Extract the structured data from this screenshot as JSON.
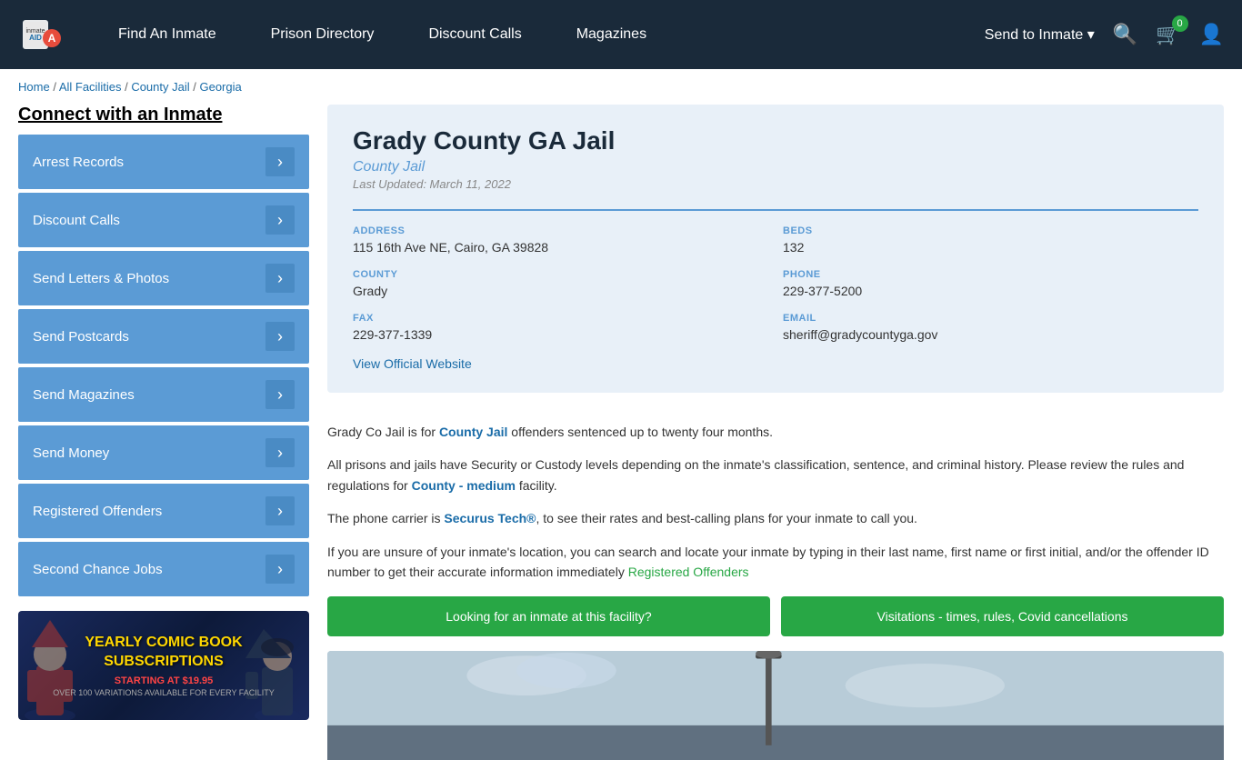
{
  "header": {
    "logo_text": "inmateAID",
    "nav_items": [
      {
        "id": "find-inmate",
        "label": "Find An Inmate"
      },
      {
        "id": "prison-directory",
        "label": "Prison Directory"
      },
      {
        "id": "discount-calls",
        "label": "Discount Calls"
      },
      {
        "id": "magazines",
        "label": "Magazines"
      }
    ],
    "send_to_inmate": "Send to Inmate ▾",
    "cart_count": "0"
  },
  "breadcrumb": {
    "items": [
      "Home",
      "All Facilities",
      "County Jail",
      "Georgia"
    ],
    "separators": " / "
  },
  "sidebar": {
    "connect_title": "Connect with an Inmate",
    "items": [
      {
        "id": "arrest-records",
        "label": "Arrest Records"
      },
      {
        "id": "discount-calls",
        "label": "Discount Calls"
      },
      {
        "id": "send-letters-photos",
        "label": "Send Letters & Photos"
      },
      {
        "id": "send-postcards",
        "label": "Send Postcards"
      },
      {
        "id": "send-magazines",
        "label": "Send Magazines"
      },
      {
        "id": "send-money",
        "label": "Send Money"
      },
      {
        "id": "registered-offenders",
        "label": "Registered Offenders"
      },
      {
        "id": "second-chance-jobs",
        "label": "Second Chance Jobs"
      }
    ],
    "ad": {
      "title": "YEARLY COMIC BOOK\nSUBSCRIPTIONS",
      "subtitle": "STARTING AT $19.95",
      "detail": "OVER 100 VARIATIONS AVAILABLE FOR EVERY FACILITY"
    }
  },
  "facility": {
    "title": "Grady County GA Jail",
    "type": "County Jail",
    "last_updated": "Last Updated: March 11, 2022",
    "address_label": "ADDRESS",
    "address_value": "115 16th Ave NE, Cairo, GA 39828",
    "beds_label": "BEDS",
    "beds_value": "132",
    "county_label": "COUNTY",
    "county_value": "Grady",
    "phone_label": "PHONE",
    "phone_value": "229-377-5200",
    "fax_label": "FAX",
    "fax_value": "229-377-1339",
    "email_label": "EMAIL",
    "email_value": "sheriff@gradycountyga.gov",
    "website_label": "View Official Website",
    "desc1": "Grady Co Jail is for County Jail offenders sentenced up to twenty four months.",
    "desc2": "All prisons and jails have Security or Custody levels depending on the inmate's classification, sentence, and criminal history. Please review the rules and regulations for County - medium facility.",
    "desc3": "The phone carrier is Securus Tech®, to see their rates and best-calling plans for your inmate to call you.",
    "desc4": "If you are unsure of your inmate's location, you can search and locate your inmate by typing in their last name, first name or first initial, and/or the offender ID number to get their accurate information immediately Registered Offenders",
    "btn_find_inmate": "Looking for an inmate at this facility?",
    "btn_visitations": "Visitations - times, rules, Covid cancellations"
  }
}
